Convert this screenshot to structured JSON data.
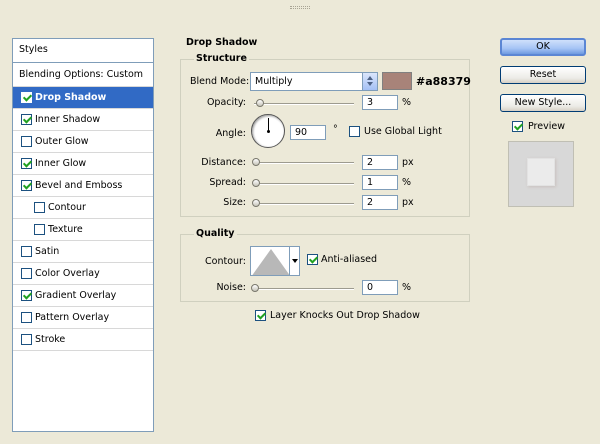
{
  "styles": {
    "header": "Styles",
    "blending_options": "Blending Options: Custom",
    "items": [
      {
        "label": "Drop Shadow",
        "checked": true,
        "selected": true,
        "sub": false
      },
      {
        "label": "Inner Shadow",
        "checked": true,
        "selected": false,
        "sub": false
      },
      {
        "label": "Outer Glow",
        "checked": false,
        "selected": false,
        "sub": false
      },
      {
        "label": "Inner Glow",
        "checked": true,
        "selected": false,
        "sub": false
      },
      {
        "label": "Bevel and Emboss",
        "checked": true,
        "selected": false,
        "sub": false
      },
      {
        "label": "Contour",
        "checked": false,
        "selected": false,
        "sub": true
      },
      {
        "label": "Texture",
        "checked": false,
        "selected": false,
        "sub": true
      },
      {
        "label": "Satin",
        "checked": false,
        "selected": false,
        "sub": false
      },
      {
        "label": "Color Overlay",
        "checked": false,
        "selected": false,
        "sub": false
      },
      {
        "label": "Gradient Overlay",
        "checked": true,
        "selected": false,
        "sub": false
      },
      {
        "label": "Pattern Overlay",
        "checked": false,
        "selected": false,
        "sub": false
      },
      {
        "label": "Stroke",
        "checked": false,
        "selected": false,
        "sub": false
      }
    ]
  },
  "drop_shadow": {
    "title": "Drop Shadow",
    "structure": {
      "title": "Structure",
      "blend_mode_label": "Blend Mode:",
      "blend_mode_value": "Multiply",
      "color_hex": "#a88379",
      "color_label": "#a88379",
      "opacity_label": "Opacity:",
      "opacity_value": "3",
      "opacity_unit": "%",
      "angle_label": "Angle:",
      "angle_value": "90",
      "angle_unit": "°",
      "use_global_light_label": "Use Global Light",
      "use_global_light_checked": false,
      "distance_label": "Distance:",
      "distance_value": "2",
      "distance_unit": "px",
      "spread_label": "Spread:",
      "spread_value": "1",
      "spread_unit": "%",
      "size_label": "Size:",
      "size_value": "2",
      "size_unit": "px"
    },
    "quality": {
      "title": "Quality",
      "contour_label": "Contour:",
      "anti_aliased_label": "Anti-aliased",
      "anti_aliased_checked": true,
      "noise_label": "Noise:",
      "noise_value": "0",
      "noise_unit": "%"
    },
    "layer_knocks_out_label": "Layer Knocks Out Drop Shadow",
    "layer_knocks_out_checked": true
  },
  "buttons": {
    "ok": "OK",
    "reset": "Reset",
    "new_style": "New Style...",
    "preview_label": "Preview",
    "preview_checked": true
  },
  "colors": {
    "selection": "#316ac5",
    "shadow_color": "#a88379"
  }
}
